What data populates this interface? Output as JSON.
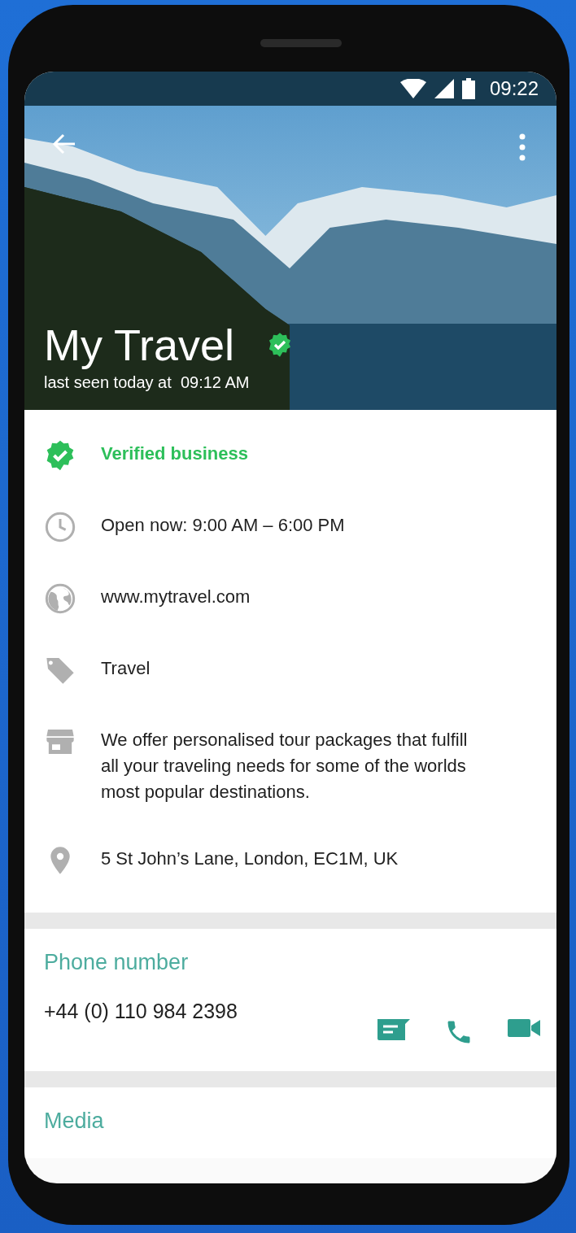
{
  "status_bar": {
    "time": "09:22"
  },
  "header": {
    "title": "My Travel",
    "verified": true,
    "last_seen": "last seen today at  09:12 AM"
  },
  "info": [
    {
      "kind": "verified",
      "text": "Verified business"
    },
    {
      "kind": "hours",
      "text": "Open now: 9:00 AM – 6:00 PM"
    },
    {
      "kind": "website",
      "text": "www.mytravel.com"
    },
    {
      "kind": "category",
      "text": "Travel"
    },
    {
      "kind": "description",
      "text": "We offer personalised tour packages that fulfill all your traveling needs for some of the worlds most popular destinations."
    },
    {
      "kind": "address",
      "text": "5 St John’s Lane, London, EC1M, UK"
    }
  ],
  "phone": {
    "heading": "Phone number",
    "number": "+44 (0) 110 984 2398",
    "actions": [
      {
        "kind": "message"
      },
      {
        "kind": "call"
      },
      {
        "kind": "video"
      }
    ]
  },
  "media": {
    "heading": "Media"
  }
}
